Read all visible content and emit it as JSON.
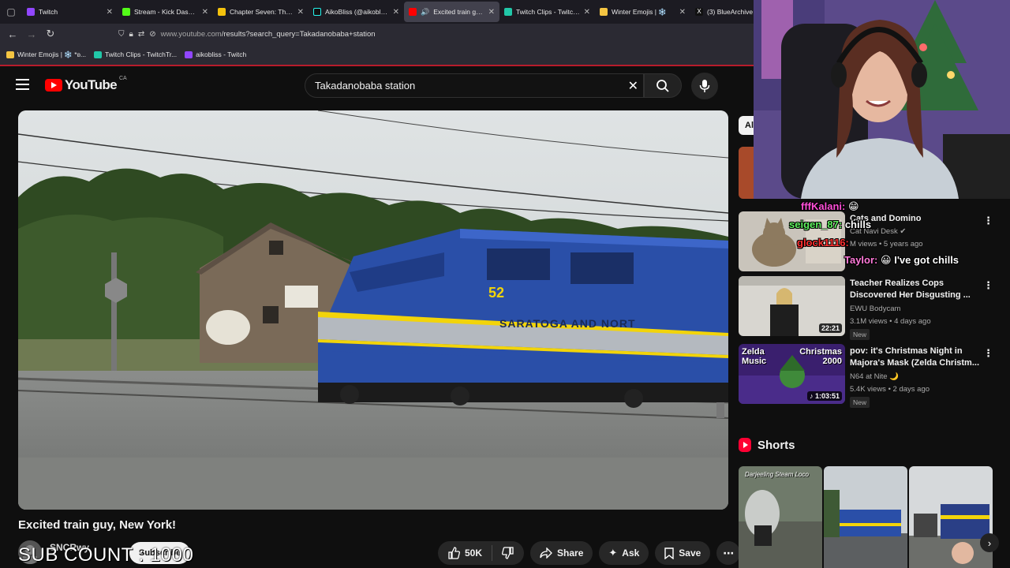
{
  "browser": {
    "tabs": [
      {
        "title": "Twitch",
        "favicon_color": "#9146ff"
      },
      {
        "title": "Stream - Kick Dashboa",
        "favicon_color": "#53fc18"
      },
      {
        "title": "Chapter Seven: The Lo",
        "favicon_color": "#f4c20d"
      },
      {
        "title": "AikoBliss (@aikobliss) |",
        "favicon_color": "#111111"
      },
      {
        "title": "Excited train guy, N",
        "favicon_color": "#ff0000",
        "active": true
      },
      {
        "title": "Twitch Clips - TwitchTra",
        "favicon_color": "#21c7a8"
      },
      {
        "title": "Winter Emojis | ❄️",
        "favicon_color": "#f5c542"
      },
      {
        "title": "(3) BlueArchive on",
        "favicon_color": "#111111"
      }
    ],
    "url_host": "www.youtube.com",
    "url_path": "/results?search_query=Takadanobaba+station",
    "bookmarks": [
      {
        "label": "Winter Emojis | ❄️ *ʚ...",
        "favicon_color": "#f5c542"
      },
      {
        "label": "Twitch Clips - TwitchTr...",
        "favicon_color": "#21c7a8"
      },
      {
        "label": "aikobliss - Twitch",
        "favicon_color": "#9146ff"
      }
    ]
  },
  "youtube": {
    "logo_word": "YouTube",
    "country_code": "CA",
    "search_query": "Takadanobaba station",
    "video": {
      "title": "Excited train guy, New York!",
      "channel": "SNCRwy",
      "subscribe_label": "Subscribe",
      "like_count": "50K",
      "share_label": "Share",
      "ask_label": "Ask",
      "save_label": "Save"
    },
    "chip_label": "Al",
    "recommendations": [
      {
        "title": "Cats and Domino",
        "channel": "Cat Navi Desk",
        "views": "M views",
        "age": "5 years ago",
        "duration": "",
        "badge": "",
        "verified": true
      },
      {
        "title": "Teacher Realizes Cops Discovered Her Disgusting ...",
        "channel": "EWU Bodycam",
        "views": "3.1M views",
        "age": "4 days ago",
        "duration": "22:21",
        "badge": "New"
      },
      {
        "title": "pov: it's Christmas Night in Majora's Mask (Zelda Christm...",
        "channel": "N64 at Nite 🌙",
        "views": "5.4K views",
        "age": "2 days ago",
        "duration": "1:03:51",
        "badge": "New",
        "thumb_text_left": "Zelda Music",
        "thumb_text_right": "Christmas 2000"
      }
    ],
    "shorts_label": "Shorts",
    "shorts_thumb_caption": "Darjeeling Steam Loco"
  },
  "stream_overlay": {
    "sub_count": "SUB COUNT : 1000",
    "chat_lines": [
      {
        "user": "fffKalani:",
        "text": "😁",
        "color": "#ff4fd8"
      },
      {
        "user": "seigen_87:",
        "text": "chills",
        "color": "#5ef05e"
      },
      {
        "user": "glock1116:",
        "text": "",
        "color": "#ff3030"
      },
      {
        "user": "Taylor:",
        "text": "I've got chills",
        "color": "#ff7ad9"
      }
    ]
  },
  "colors": {
    "accent_red": "#ff0000",
    "bookmark_bar_underline": "#b71c2c",
    "train_blue": "#2a4fa8",
    "train_yellow": "#f2d40a"
  }
}
